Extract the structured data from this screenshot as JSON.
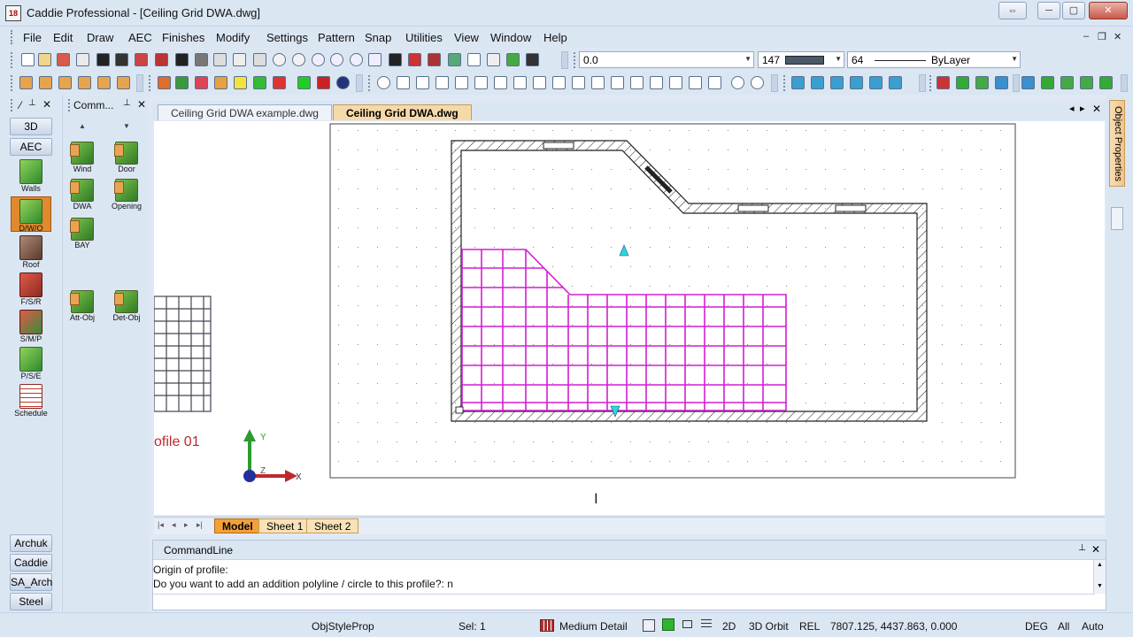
{
  "window": {
    "app_icon_text": "18",
    "title": "Caddie Professional - [Ceiling Grid DWA.dwg]",
    "restore_glyph": "⇔",
    "minimize_glyph": "─",
    "maximize_glyph": "▢",
    "close_glyph": "✕"
  },
  "menu": {
    "items": [
      "File",
      "Edit",
      "Draw",
      "AEC",
      "Finishes",
      "Modify",
      "Settings",
      "Pattern",
      "Snap",
      "Utilities",
      "View",
      "Window",
      "Help"
    ],
    "mdi_min": "‒",
    "mdi_restore": "❐",
    "mdi_close": "✕"
  },
  "properties": {
    "elevation": "0.0",
    "color_index": "147",
    "color_swatch": "#4a5a66",
    "linetype_index": "64",
    "layer": "ByLayer"
  },
  "left_panel": {
    "header_label": "⁄",
    "pin": "📌",
    "close": "✕",
    "categories_top": [
      "3D",
      "AEC"
    ],
    "tools": [
      {
        "label": "Walls",
        "icon": "walls-icon",
        "color": "#4fa83a"
      },
      {
        "label": "D/W/O",
        "icon": "door-window-opening-icon",
        "color": "#4fa83a"
      },
      {
        "label": "Roof",
        "icon": "roof-icon",
        "color": "#8d6b58"
      },
      {
        "label": "F/S/R",
        "icon": "floor-stair-ramp-icon",
        "color": "#c0392b"
      },
      {
        "label": "S/M/P",
        "icon": "structural-icon",
        "color": "#c0392b"
      },
      {
        "label": "P/S/E",
        "icon": "plumbing-icon",
        "color": "#3f9a3a"
      },
      {
        "label": "Schedule",
        "icon": "schedule-icon",
        "color": "#c0392b"
      }
    ],
    "categories_bottom": [
      "Archuk",
      "Caddie",
      "SA_Arch",
      "Steel"
    ]
  },
  "command_panel": {
    "title": "Comm...",
    "pin": "📌",
    "close": "✕",
    "scroll_up": "▲",
    "scroll_down": "▼",
    "tools": [
      {
        "label": "Wind"
      },
      {
        "label": "Door"
      },
      {
        "label": "DWA"
      },
      {
        "label": "Opening"
      },
      {
        "label": "BAY"
      },
      {
        "label": "Att-Obj"
      },
      {
        "label": "Det-Obj"
      }
    ]
  },
  "doc_tabs": {
    "tabs": [
      "Ceiling Grid DWA example.dwg",
      "Ceiling Grid DWA.dwg"
    ],
    "nav_left": "◂",
    "nav_right": "▸",
    "close": "✕"
  },
  "canvas": {
    "profile_text": "ofile 01",
    "axis_x": "X",
    "axis_y": "Y",
    "axis_z": "Z"
  },
  "sheet_tabs": {
    "nav": [
      "|◂",
      "◂",
      "▸",
      "▸|"
    ],
    "tabs": [
      "Model",
      "Sheet 1",
      "Sheet 2"
    ]
  },
  "command_line": {
    "title": "CommandLine",
    "pin": "📌",
    "close": "✕",
    "lines": [
      "Origin of profile:",
      "Do you want to add an addition polyline / circle to this profile?: n"
    ]
  },
  "right_panel": {
    "tab_label": "Object Properties"
  },
  "status": {
    "obj_style": "ObjStyleProp",
    "selection": "Sel: 1",
    "detail": "Medium Detail",
    "view_2d": "2D",
    "orbit": "3D Orbit",
    "rel": "REL",
    "coords": "7807.125, 4437.863, 0.000",
    "units": "DEG",
    "all": "All",
    "auto": "Auto"
  }
}
